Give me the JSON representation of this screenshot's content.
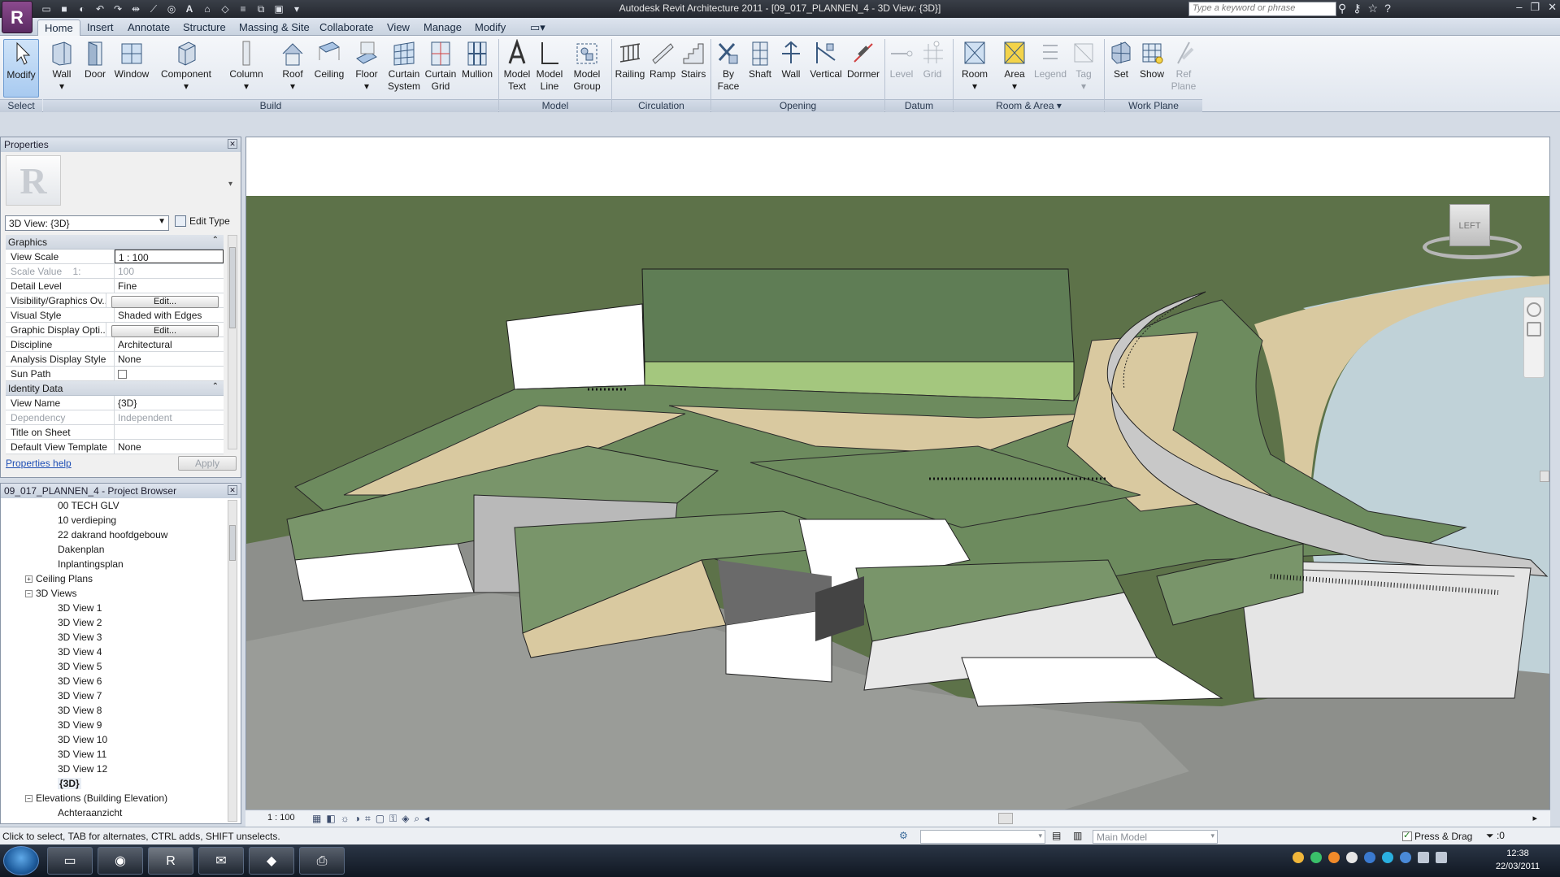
{
  "app": {
    "title": "Autodesk Revit Architecture 2011 - [09_017_PLANNEN_4 - 3D View: {3D}]",
    "logo_letter": "R",
    "search_placeholder": "Type a keyword or phrase"
  },
  "ribbon_tabs": [
    "Home",
    "Insert",
    "Annotate",
    "Structure",
    "Massing & Site",
    "Collaborate",
    "View",
    "Manage",
    "Modify"
  ],
  "ribbon": {
    "buttons": [
      {
        "label": "Modify",
        "icon": "cursor-icon"
      },
      {
        "label": "Wall",
        "icon": "wall-icon"
      },
      {
        "label": "Door",
        "icon": "door-icon"
      },
      {
        "label": "Window",
        "icon": "window-icon"
      },
      {
        "label": "Component",
        "icon": "component-icon"
      },
      {
        "label": "Column",
        "icon": "column-icon"
      },
      {
        "label": "Roof",
        "icon": "roof-icon"
      },
      {
        "label": "Ceiling",
        "icon": "ceiling-icon"
      },
      {
        "label": "Floor",
        "icon": "floor-icon"
      },
      {
        "label": "Curtain System",
        "icon": "curtain-system-icon"
      },
      {
        "label": "Curtain Grid",
        "icon": "curtain-grid-icon"
      },
      {
        "label": "Mullion",
        "icon": "mullion-icon"
      },
      {
        "label": "Model Text",
        "icon": "model-text-icon"
      },
      {
        "label": "Model Line",
        "icon": "model-line-icon"
      },
      {
        "label": "Model Group",
        "icon": "model-group-icon"
      },
      {
        "label": "Railing",
        "icon": "railing-icon"
      },
      {
        "label": "Ramp",
        "icon": "ramp-icon"
      },
      {
        "label": "Stairs",
        "icon": "stairs-icon"
      },
      {
        "label": "By Face",
        "icon": "by-face-icon"
      },
      {
        "label": "Shaft",
        "icon": "shaft-icon"
      },
      {
        "label": "Wall",
        "icon": "wall-opening-icon"
      },
      {
        "label": "Vertical",
        "icon": "vertical-icon"
      },
      {
        "label": "Dormer",
        "icon": "dormer-icon"
      },
      {
        "label": "Level",
        "icon": "level-icon"
      },
      {
        "label": "Grid",
        "icon": "grid-icon"
      },
      {
        "label": "Room",
        "icon": "room-icon"
      },
      {
        "label": "Area",
        "icon": "area-icon"
      },
      {
        "label": "Legend",
        "icon": "legend-icon"
      },
      {
        "label": "Tag",
        "icon": "tag-icon"
      },
      {
        "label": "Set",
        "icon": "set-icon"
      },
      {
        "label": "Show",
        "icon": "show-icon"
      },
      {
        "label": "Ref Plane",
        "icon": "ref-plane-icon"
      }
    ],
    "panels": [
      "Select",
      "Build",
      "Model",
      "Circulation",
      "Opening",
      "Datum",
      "Room & Area ▾",
      "Work Plane"
    ]
  },
  "properties": {
    "title": "Properties",
    "type_selector": "3D View: {3D}",
    "edit_type": "Edit Type",
    "sections": [
      {
        "name": "Graphics",
        "rows": [
          {
            "key": "View Scale",
            "value": "1 : 100"
          },
          {
            "key": "Scale Value    1:",
            "value": "100"
          },
          {
            "key": "Detail Level",
            "value": "Fine"
          },
          {
            "key": "Visibility/Graphics Ov...",
            "value": "Edit..."
          },
          {
            "key": "Visual Style",
            "value": "Shaded with Edges"
          },
          {
            "key": "Graphic Display Opti...",
            "value": "Edit..."
          },
          {
            "key": "Discipline",
            "value": "Architectural"
          },
          {
            "key": "Analysis Display Style",
            "value": "None"
          },
          {
            "key": "Sun Path",
            "value": ""
          }
        ]
      },
      {
        "name": "Identity Data",
        "rows": [
          {
            "key": "View Name",
            "value": "{3D}"
          },
          {
            "key": "Dependency",
            "value": "Independent"
          },
          {
            "key": "Title on Sheet",
            "value": ""
          },
          {
            "key": "Default View Template",
            "value": "None"
          }
        ]
      }
    ],
    "help_link": "Properties help",
    "apply": "Apply"
  },
  "browser": {
    "title": "09_017_PLANNEN_4 - Project Browser",
    "items": [
      "00 TECH GLV",
      "10 verdieping",
      "22 dakrand hoofdgebouw",
      "Dakenplan",
      "Inplantingsplan",
      "Ceiling Plans",
      "3D Views",
      "3D View 1",
      "3D View 2",
      "3D View 3",
      "3D View 4",
      "3D View 5",
      "3D View 6",
      "3D View 7",
      "3D View 8",
      "3D View 9",
      "3D View 10",
      "3D View 11",
      "3D View 12",
      "{3D}",
      "Elevations (Building Elevation)",
      "Achteraanzicht"
    ]
  },
  "viewport": {
    "viewcube_label": "LEFT",
    "scale": "1 : 100"
  },
  "status": {
    "message": "Click to select, TAB for alternates, CTRL adds, SHIFT unselects.",
    "workset": "",
    "model": "Main Model",
    "press_drag": "Press & Drag",
    "filter_count": ":0"
  },
  "taskbar": {
    "time": "12:38",
    "date": "22/03/2011"
  },
  "colors": {
    "grass": "#5f7a4e",
    "roof_light": "#a7c47b",
    "path_beige": "#d8c79e",
    "water": "#b9cbd1",
    "accent": "#6d9bd1"
  }
}
